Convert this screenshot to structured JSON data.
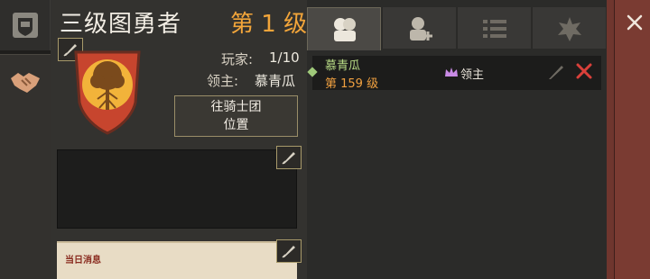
{
  "guild": {
    "name": "三级图勇者",
    "level": "第 1 级",
    "players_label": "玩家:",
    "players_value": "1/10",
    "leader_label": "领主:",
    "leader_value": "慕青瓜",
    "location_button": [
      "往骑士团",
      "位置"
    ]
  },
  "daily_message": {
    "label": "当日消息"
  },
  "tabs": [
    {
      "icon": "knights-group-icon",
      "active": true
    },
    {
      "icon": "add-knight-icon",
      "active": false
    },
    {
      "icon": "list-icon",
      "active": false
    },
    {
      "icon": "badge-icon",
      "active": false
    }
  ],
  "members": [
    {
      "name": "慕青瓜",
      "level": "第 159 级",
      "role": "领主"
    }
  ],
  "colors": {
    "level_orange": "#f2a53a",
    "member_green": "#b9dc86",
    "remove_red": "#d9403a",
    "crest_red": "#c7452e"
  }
}
